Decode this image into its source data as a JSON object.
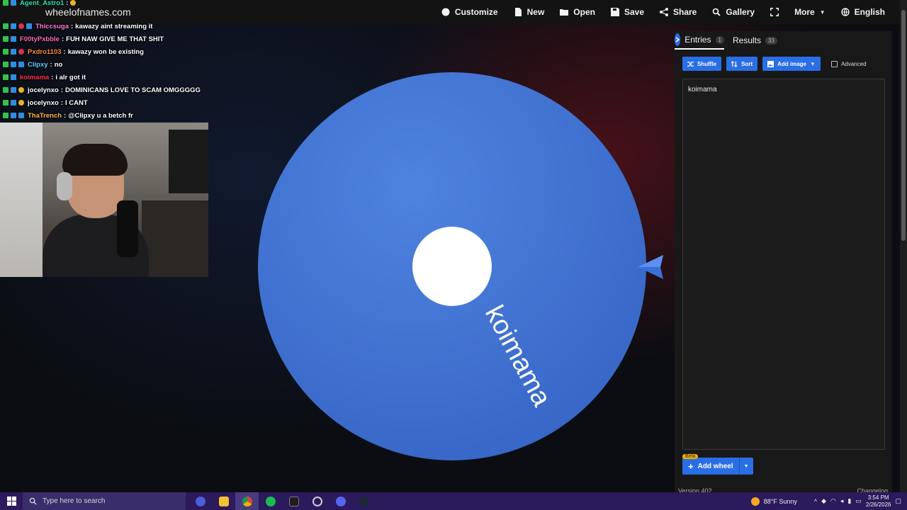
{
  "site": {
    "brand": "wheelofnames.com"
  },
  "nav": {
    "items": [
      {
        "label": "Customize",
        "icon": "palette-icon"
      },
      {
        "label": "New",
        "icon": "file-icon"
      },
      {
        "label": "Open",
        "icon": "folder-icon"
      },
      {
        "label": "Save",
        "icon": "save-icon"
      },
      {
        "label": "Share",
        "icon": "share-icon"
      },
      {
        "label": "Gallery",
        "icon": "search-icon"
      },
      {
        "label": "",
        "icon": "fullscreen-icon"
      },
      {
        "label": "More",
        "icon": "caret-down-icon"
      },
      {
        "label": "English",
        "icon": "globe-icon"
      }
    ]
  },
  "chat": {
    "messages": [
      {
        "user": "Agent_Astro1",
        "text": "",
        "color": "#32e0b0"
      },
      {
        "user": "",
        "text": "",
        "color": "#d8334a"
      },
      {
        "user": "Thiccsuga",
        "text": "kawazy aint streaming it",
        "color": "#ff7bd3"
      },
      {
        "user": "F00tyPxbble",
        "text": "FUH NAW GIVE ME THAT SHIT",
        "color": "#ff69b4"
      },
      {
        "user": "Pxdro1103",
        "text": "kawazy won be existing",
        "color": "#ff8c3a"
      },
      {
        "user": "Clipxy",
        "text": "no",
        "color": "#5fd0ff"
      },
      {
        "user": "koimama",
        "text": "i alr got it",
        "color": "#ff2f4a"
      },
      {
        "user": "jocelynxo",
        "text": "DOMINICANS LOVE TO SCAM OMGGGGG",
        "color": "#ffffff"
      },
      {
        "user": "jocelynxo",
        "text": "I CANT",
        "color": "#ffffff"
      },
      {
        "user": "ThaTrench",
        "text": "@Clipxy u a betch fr",
        "color": "#ffb84a"
      }
    ]
  },
  "wheel": {
    "entry_label": "koimama",
    "color": "#3f74d6"
  },
  "panel": {
    "tab_entries": "Entries",
    "tab_entries_count": "1",
    "tab_results": "Results",
    "tab_results_count": "33",
    "shuffle": "Shuffle",
    "sort": "Sort",
    "add_image": "Add image",
    "advanced": "Advanced",
    "entries_text": "koimama",
    "add_wheel": "Add wheel",
    "beta": "Beta",
    "version": "Version 402",
    "changelog": "Changelog"
  },
  "taskbar": {
    "search_placeholder": "Type here to search",
    "weather": "88°F  Sunny",
    "time": "3:54 PM",
    "date": "2/26/2026"
  },
  "colors": {
    "accent": "#2a6ee6",
    "taskbar": "#2b1a5c"
  }
}
